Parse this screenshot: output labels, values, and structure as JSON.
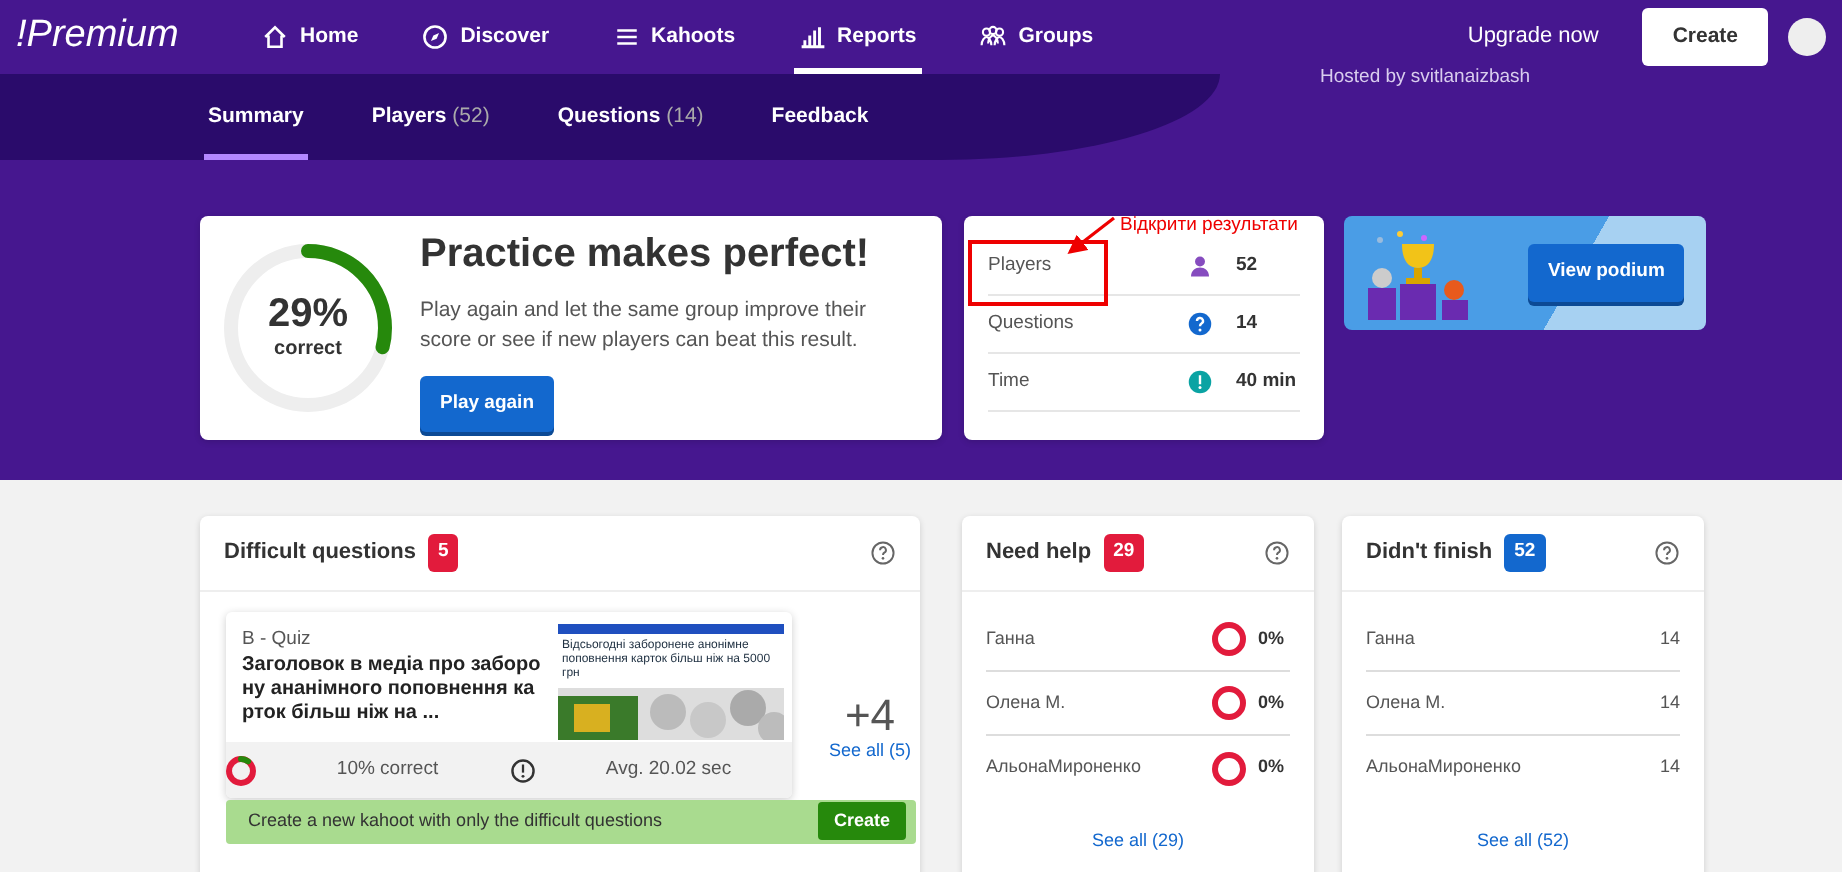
{
  "navbar": {
    "logo": "!Premium",
    "items": [
      {
        "label": "Home",
        "kind": "home",
        "selected": false
      },
      {
        "label": "Discover",
        "kind": "discover",
        "selected": false
      },
      {
        "label": "Kahoots",
        "kind": "library",
        "selected": false
      },
      {
        "label": "Reports",
        "kind": "reports",
        "selected": true
      },
      {
        "label": "Groups",
        "kind": "groups",
        "selected": false
      }
    ],
    "upgrade": "Upgrade now",
    "create": "Create"
  },
  "subtabs": [
    {
      "label": "Summary",
      "selected": true
    },
    {
      "label": "Players",
      "count": "(52)",
      "selected": false
    },
    {
      "label": "Questions",
      "count": "(14)",
      "selected": false
    },
    {
      "label": "Feedback",
      "selected": false
    }
  ],
  "hosted": "Hosted by svitlanaizbash",
  "hero": {
    "percent": "29%",
    "caption": "correct",
    "level": 0.29,
    "title": "Practice makes perfect!",
    "text": "Play again and let the same group improve their score or see if new players can beat this result.",
    "button": "Play again"
  },
  "stats": {
    "rows": [
      {
        "label": "Players",
        "kind": "players",
        "value": "52"
      },
      {
        "label": "Questions",
        "kind": "questions",
        "value": "14"
      },
      {
        "label": "Time",
        "kind": "time",
        "value": "40 min"
      }
    ],
    "annotation": "Відкрити результати"
  },
  "podium": {
    "button": "View podium"
  },
  "difficult": {
    "title": "Difficult questions",
    "badge": "5",
    "color": "#e21b3c",
    "question": {
      "type": "B - Quiz",
      "title": "Заголовок в медіа про заборону ананімного поповнення карток більш ніж на ...",
      "headline": "Відсьогодні заборонене анонімне поповнення карток більш ніж на 5000 грн",
      "correct": "10% correct",
      "level": 0.1,
      "avg": "Avg. 20.02 sec"
    },
    "more": "+4",
    "see_all": "See all (5)",
    "banner": "Create a new kahoot with only the difficult questions",
    "banner_button": "Create"
  },
  "need_help": {
    "title": "Need help",
    "badge": "29",
    "color": "#e21b3c",
    "rows": [
      {
        "name": "Ганна",
        "percent": "0%"
      },
      {
        "name": "Олена М.",
        "percent": "0%"
      },
      {
        "name": "АльонаМироненко",
        "percent": "0%"
      }
    ],
    "see_all": "See all (29)"
  },
  "didnt_finish": {
    "title": "Didn't finish",
    "badge": "52",
    "color": "#1368ce",
    "rows": [
      {
        "name": "Ганна",
        "value": "14"
      },
      {
        "name": "Олена М.",
        "value": "14"
      },
      {
        "name": "АльонаМироненко",
        "value": "14"
      }
    ],
    "see_all": "See all (52)"
  }
}
